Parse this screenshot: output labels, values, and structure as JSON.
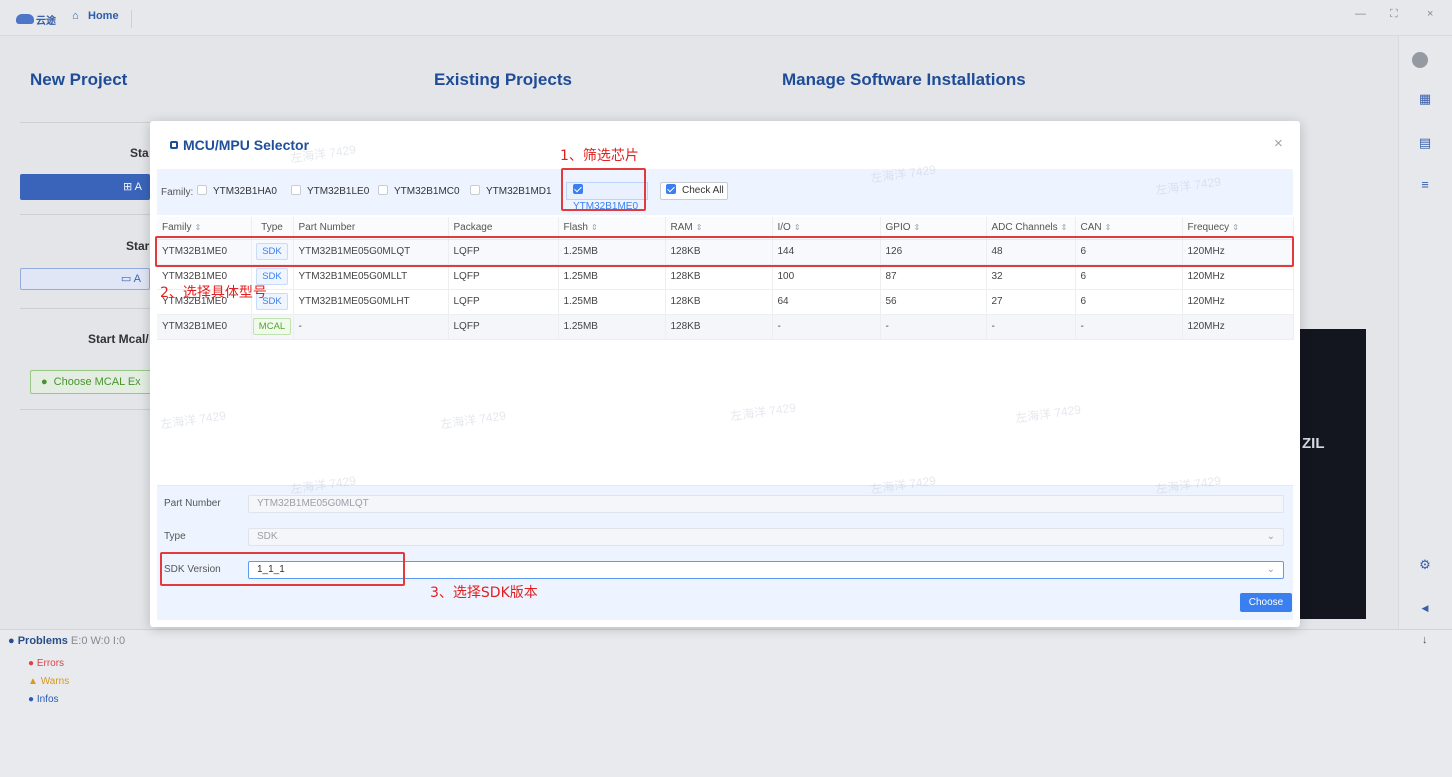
{
  "titlebar": {
    "home_label": "Home",
    "minimize": "—",
    "maximize": "⛶",
    "close": "×"
  },
  "logo": {
    "text": "云途"
  },
  "home": {
    "new_project": "New Project",
    "existing_projects": "Existing Projects",
    "manage_installations": "Manage Software Installations",
    "start_1": "Sta",
    "btn_1": "⊞ A",
    "start_2": "Star",
    "btn_2": "▭ A",
    "start_mcal": "Start Mcal/",
    "choose_mcal": "Choose MCAL Ex",
    "dark_text": "ZIL"
  },
  "modal": {
    "title": "MCU/MPU Selector",
    "family_label": "Family:",
    "families": [
      {
        "name": "YTM32B1HA0",
        "checked": false
      },
      {
        "name": "YTM32B1LE0",
        "checked": false
      },
      {
        "name": "YTM32B1MC0",
        "checked": false
      },
      {
        "name": "YTM32B1MD1",
        "checked": false
      },
      {
        "name": "YTM32B1ME0",
        "checked": true
      }
    ],
    "check_all": "Check All",
    "columns": [
      "Family",
      "Type",
      "Part Number",
      "Package",
      "Flash",
      "RAM",
      "I/O",
      "GPIO",
      "ADC Channels",
      "CAN",
      "Frequecy"
    ],
    "rows": [
      [
        "YTM32B1ME0",
        "SDK",
        "YTM32B1ME05G0MLQT",
        "LQFP",
        "1.25MB",
        "128KB",
        "144",
        "126",
        "48",
        "6",
        "120MHz"
      ],
      [
        "YTM32B1ME0",
        "SDK",
        "YTM32B1ME05G0MLLT",
        "LQFP",
        "1.25MB",
        "128KB",
        "100",
        "87",
        "32",
        "6",
        "120MHz"
      ],
      [
        "YTM32B1ME0",
        "SDK",
        "YTM32B1ME05G0MLHT",
        "LQFP",
        "1.25MB",
        "128KB",
        "64",
        "56",
        "27",
        "6",
        "120MHz"
      ],
      [
        "YTM32B1ME0",
        "MCAL",
        "-",
        "LQFP",
        "1.25MB",
        "128KB",
        "-",
        "-",
        "-",
        "-",
        "120MHz"
      ]
    ],
    "part_number_label": "Part Number",
    "part_number_value": "YTM32B1ME05G0MLQT",
    "type_label": "Type",
    "type_value": "SDK",
    "sdk_version_label": "SDK Version",
    "sdk_version_value": "1_1_1",
    "choose_button": "Choose",
    "watermark": "左海洋 7429"
  },
  "annotations": {
    "step1": "1、筛选芯片",
    "step2": "2、选择具体型号",
    "step3": "3、选择SDK版本"
  },
  "problems": {
    "title": "Problems",
    "counts": "E:0 W:0 I:0",
    "errors": "Errors",
    "warns": "Warns",
    "infos": "Infos"
  },
  "colors": {
    "accent": "#3a7ff0",
    "brand": "#1f4e9c",
    "annotation": "#e23b3b"
  }
}
